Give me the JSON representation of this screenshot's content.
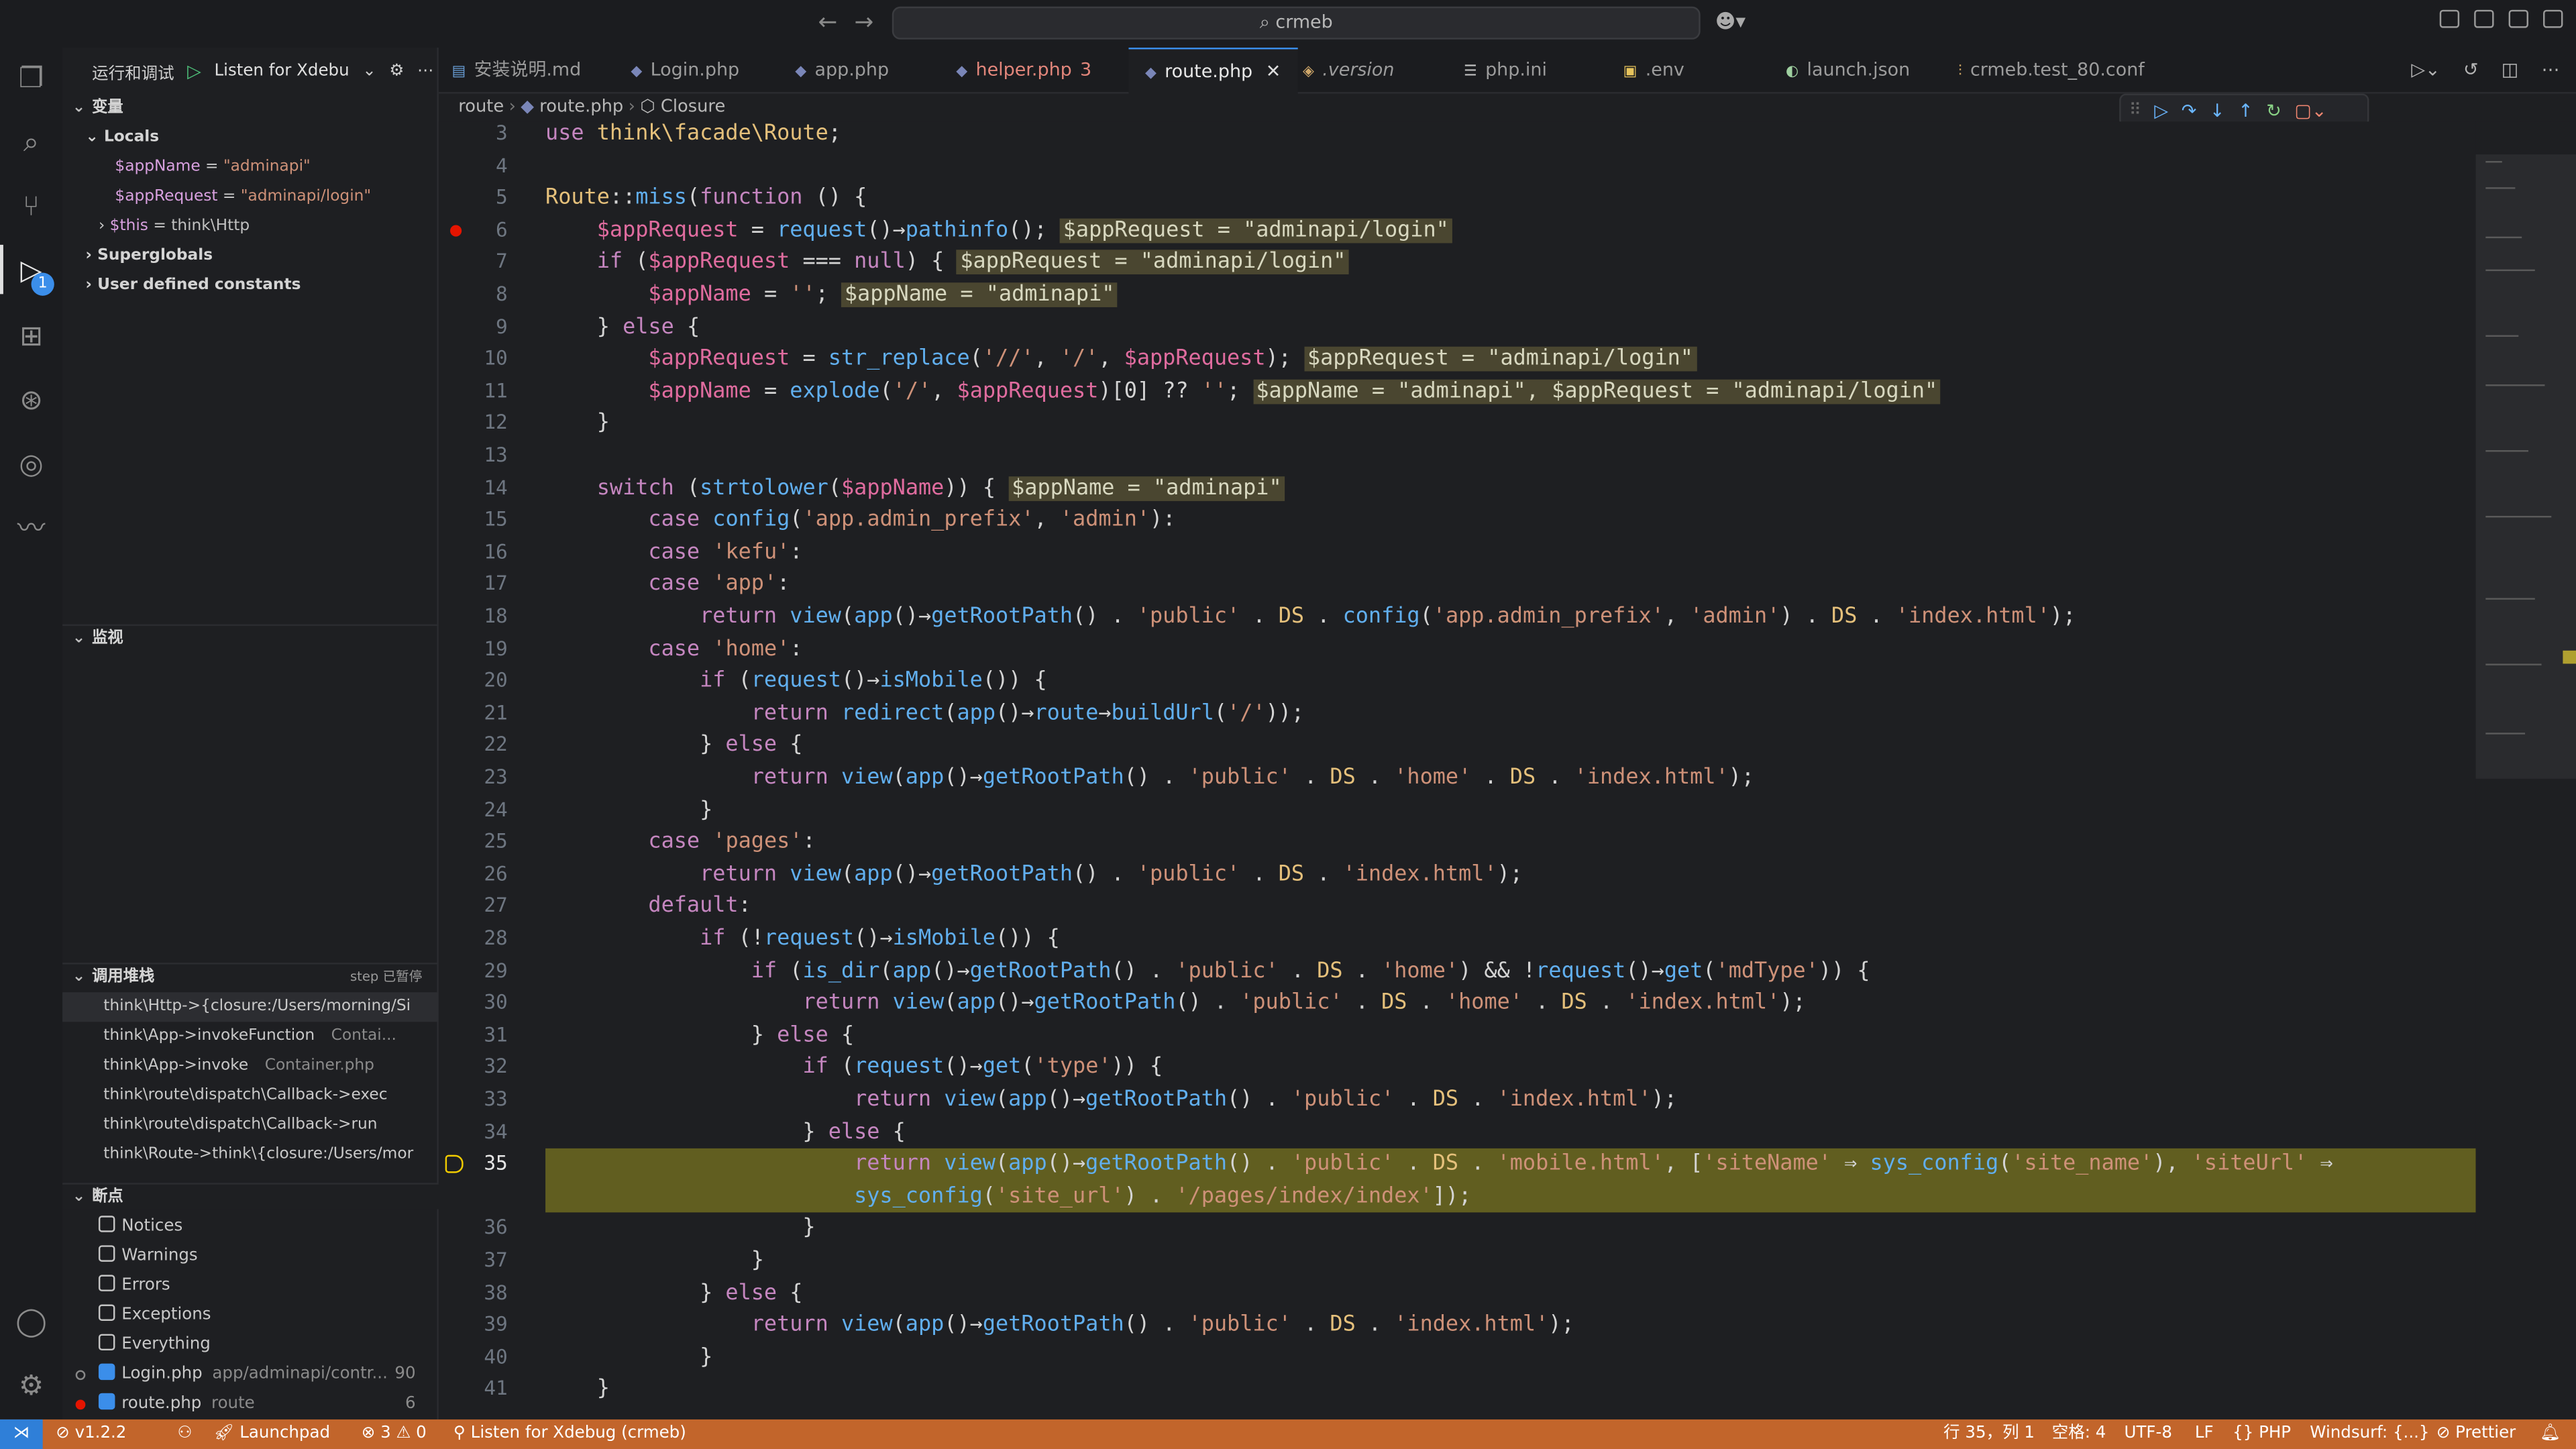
{
  "titlebar": {
    "search": "crmeb",
    "back": "←",
    "forward": "→"
  },
  "run_panel": {
    "title": "运行和调试",
    "config": "Listen for Xdebu",
    "variables": {
      "header": "变量",
      "locals_label": "Locals",
      "locals": [
        {
          "name": "$appName",
          "value": "\"adminapi\""
        },
        {
          "name": "$appRequest",
          "value": "\"adminapi/login\""
        },
        {
          "name": "$this",
          "value": "think\\Http"
        }
      ],
      "superglobals": "Superglobals",
      "constants": "User defined constants"
    },
    "watch": {
      "header": "监视"
    },
    "callstack": {
      "header": "调用堆栈",
      "status": "step 已暂停",
      "frames": [
        {
          "name": "think\\Http->{closure:/Users/morning/Si",
          "file": ""
        },
        {
          "name": "think\\App->invokeFunction",
          "file": "Contai..."
        },
        {
          "name": "think\\App->invoke",
          "file": "Container.php"
        },
        {
          "name": "think\\route\\dispatch\\Callback->exec",
          "file": ""
        },
        {
          "name": "think\\route\\dispatch\\Callback->run",
          "file": ""
        },
        {
          "name": "think\\Route->think\\{closure:/Users/mor",
          "file": ""
        }
      ]
    },
    "breakpoints": {
      "header": "断点",
      "items": [
        {
          "label": "Notices",
          "checked": false
        },
        {
          "label": "Warnings",
          "checked": false
        },
        {
          "label": "Errors",
          "checked": false
        },
        {
          "label": "Exceptions",
          "checked": false
        },
        {
          "label": "Everything",
          "checked": false
        },
        {
          "label": "Login.php",
          "path": "app/adminapi/contr...",
          "line": "90",
          "checked": true
        },
        {
          "label": "route.php",
          "path": "route",
          "line": "6",
          "checked": true
        }
      ]
    }
  },
  "tabs": [
    {
      "label": "安装说明.md",
      "icon": "markdown-icon"
    },
    {
      "label": "Login.php",
      "icon": "php-icon"
    },
    {
      "label": "app.php",
      "icon": "php-icon"
    },
    {
      "label": "helper.php",
      "count": "3",
      "icon": "php-icon",
      "modified": true
    },
    {
      "label": "route.php",
      "icon": "php-icon",
      "active": true
    },
    {
      "label": ".version",
      "icon": "tag-icon"
    },
    {
      "label": "php.ini",
      "icon": "ini-icon"
    },
    {
      "label": ".env",
      "icon": "env-icon"
    },
    {
      "label": "launch.json",
      "icon": "json-icon"
    },
    {
      "label": "crmeb.test_80.conf",
      "icon": "settings-file-icon"
    }
  ],
  "breadcrumb": {
    "folder": "route",
    "file": "route.php",
    "symbol": "Closure"
  },
  "editor": {
    "line_numbers": [
      "3",
      "4",
      "5",
      "6",
      "7",
      "8",
      "9",
      "10",
      "11",
      "12",
      "13",
      "14",
      "15",
      "16",
      "17",
      "18",
      "19",
      "20",
      "21",
      "22",
      "23",
      "24",
      "25",
      "26",
      "27",
      "28",
      "29",
      "30",
      "31",
      "32",
      "33",
      "34",
      "35",
      "",
      "36",
      "37",
      "38",
      "39",
      "40",
      "41"
    ],
    "inline_values": {
      "l6": "$appRequest = \"adminapi/login\"",
      "l7": "$appRequest = \"adminapi/login\"",
      "l8": "$appName = \"adminapi\"",
      "l10": "$appRequest = \"adminapi/login\"",
      "l11": "$appName = \"adminapi\", $appRequest = \"adminapi/login\"",
      "l14": "$appName = \"adminapi\""
    }
  },
  "status": {
    "version": "v1.2.2",
    "launchpad": "Launchpad",
    "problems": "⊗ 3 ⚠ 0",
    "debug": "Listen for Xdebug (crmeb)",
    "position": "行 35，列 1",
    "spaces": "空格: 4",
    "encoding": "UTF-8",
    "eol": "LF",
    "lang": "PHP",
    "windsurf": "Windsurf: {...}",
    "prettier": "Prettier"
  },
  "colors": {
    "statusbar": "#c2652b",
    "accent": "#3b8eea",
    "current_line": "#615e20"
  }
}
